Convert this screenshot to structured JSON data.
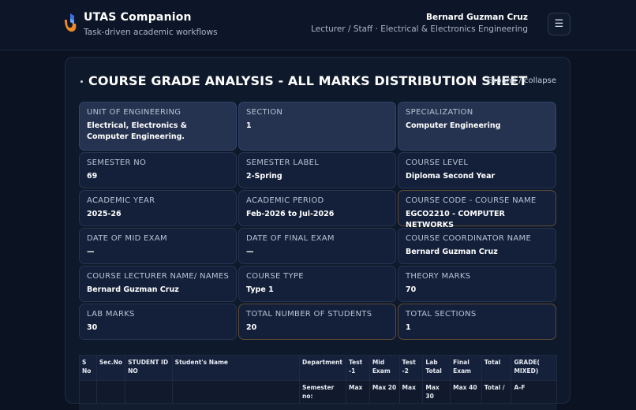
{
  "header": {
    "app_title": "UTAS Companion",
    "app_subtitle": "Task-driven academic workflows",
    "user_name": "Bernard Guzman Cruz",
    "user_role": "Lecturer / Staff · Electrical & Electronics Engineering",
    "menu_icon": "☰"
  },
  "card": {
    "title": "COURSE GRADE ANALYSIS - ALL MARKS DISTRIBUTION SHEET",
    "expand_label": "Expand / collapse"
  },
  "fields": [
    {
      "label": "UNIT OF ENGINEERING",
      "value": "Electrical, Electronics & Computer Engineering."
    },
    {
      "label": "SECTION",
      "value": "1"
    },
    {
      "label": "SPECIALIZATION",
      "value": "Computer Engineering"
    },
    {
      "label": "SEMESTER NO",
      "value": "69"
    },
    {
      "label": "SEMESTER LABEL",
      "value": "2-Spring"
    },
    {
      "label": "COURSE LEVEL",
      "value": "Diploma Second Year"
    },
    {
      "label": "ACADEMIC YEAR",
      "value": "2025-26"
    },
    {
      "label": "ACADEMIC PERIOD",
      "value": "Feb-2026 to Jul-2026"
    },
    {
      "label": "COURSE CODE - COURSE NAME",
      "value": "EGCO2210 - COMPUTER NETWORKS"
    },
    {
      "label": "DATE OF MID EXAM",
      "value": "—"
    },
    {
      "label": "DATE OF FINAL EXAM",
      "value": "—"
    },
    {
      "label": "COURSE COORDINATOR NAME",
      "value": "Bernard Guzman Cruz"
    },
    {
      "label": "COURSE LECTURER NAME/ NAMES",
      "value": "Bernard Guzman Cruz"
    },
    {
      "label": "COURSE TYPE",
      "value": "Type 1"
    },
    {
      "label": "THEORY MARKS",
      "value": "70"
    },
    {
      "label": "LAB MARKS",
      "value": "30"
    },
    {
      "label": "TOTAL NUMBER OF STUDENTS",
      "value": "20"
    },
    {
      "label": "TOTAL SECTIONS",
      "value": "1"
    }
  ],
  "table": {
    "headers": [
      "S No",
      "Sec.No",
      "STUDENT ID NO",
      "Student's Name",
      "Department",
      "Test -1",
      "Mid Exam",
      "Test -2",
      "Lab Total",
      "Final Exam",
      "Total",
      "GRADE( MIXED)"
    ],
    "row1": [
      "",
      "",
      "",
      "",
      "Semester no:",
      "Max",
      "Max 20",
      "Max",
      "Max 30",
      "Max 40",
      "Total /",
      "A-F"
    ]
  }
}
